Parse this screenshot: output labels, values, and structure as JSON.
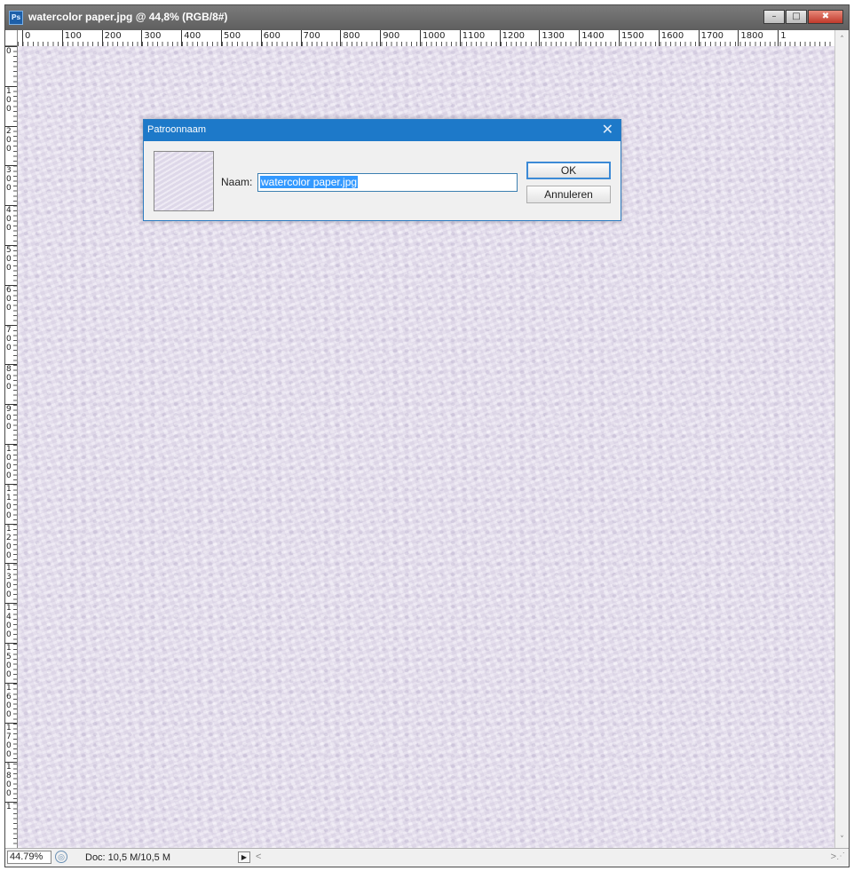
{
  "window": {
    "title": "watercolor paper.jpg @ 44,8% (RGB/8#)",
    "app_icon_label": "Ps",
    "buttons": {
      "minimize": "–",
      "maximize": "□",
      "close": "✖"
    }
  },
  "ruler": {
    "horizontal_labels": [
      "0",
      "100",
      "200",
      "300",
      "400",
      "500",
      "600",
      "700",
      "800",
      "900",
      "1000",
      "1100",
      "1200",
      "1300",
      "1400",
      "1500",
      "1600",
      "1700",
      "1800",
      "1"
    ],
    "vertical_labels": [
      "0",
      "1\n0\n0",
      "2\n0\n0",
      "3\n0\n0",
      "4\n0\n0",
      "5\n0\n0",
      "6\n0\n0",
      "7\n0\n0",
      "8\n0\n0",
      "9\n0\n0",
      "1\n0\n0\n0",
      "1\n1\n0\n0",
      "1\n2\n0\n0",
      "1\n3\n0\n0",
      "1\n4\n0\n0",
      "1\n5\n0\n0",
      "1\n6\n0\n0",
      "1\n7\n0\n0",
      "1\n8\n0\n0",
      "1"
    ]
  },
  "status": {
    "zoom": "44.79%",
    "doc": "Doc: 10,5 M/10,5 M",
    "menu_arrow": "▶"
  },
  "scroll": {
    "up": "˄",
    "down": "˅",
    "left": "<",
    "right": ">"
  },
  "dialog": {
    "title": "Patroonnaam",
    "close": "✕",
    "name_label": "Naam:",
    "name_value": "watercolor paper.jpg",
    "ok_label": "OK",
    "cancel_label": "Annuleren"
  },
  "colors": {
    "dialog_title_bar": "#1d79c9",
    "canvas_texture": "#e7e1ef",
    "selection": "#3399ff"
  }
}
